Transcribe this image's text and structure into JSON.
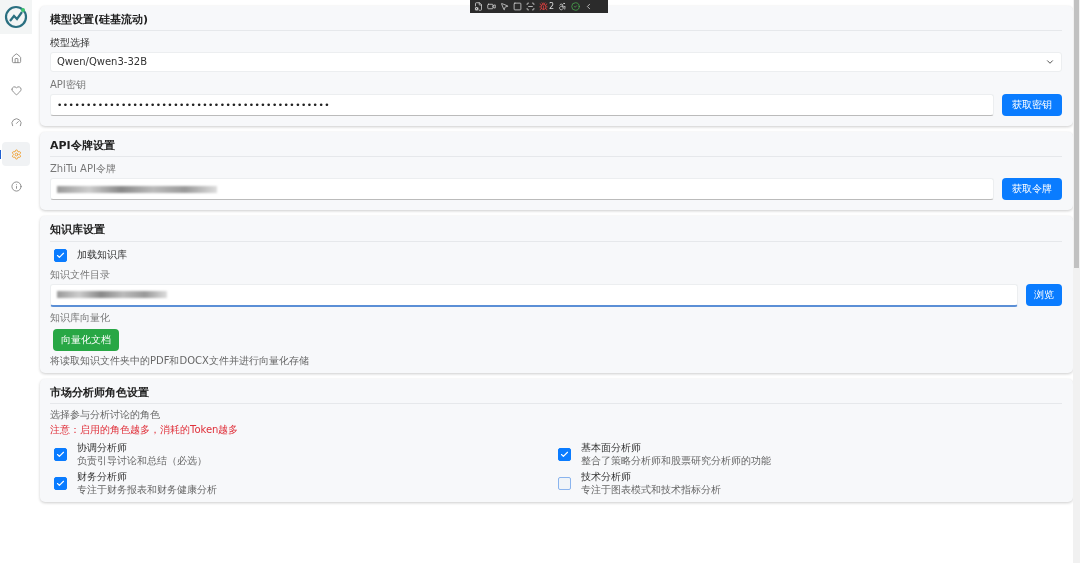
{
  "sidebar": {
    "items": [
      {
        "kind": "home",
        "selected": false
      },
      {
        "kind": "heart",
        "selected": false
      },
      {
        "kind": "gauge",
        "selected": false
      },
      {
        "kind": "settings",
        "selected": true
      },
      {
        "kind": "info",
        "selected": false
      }
    ]
  },
  "debug_toolbar": {
    "issue_count": "2"
  },
  "model_settings": {
    "title": "模型设置(硅基流动)",
    "model_label": "模型选择",
    "model_value": "Qwen/Qwen3-32B",
    "key_label": "API密钥",
    "key_value": "•••••••••••••••••••••••••••••••••••••••••••••••",
    "key_button": "获取密钥"
  },
  "token_settings": {
    "title": "API令牌设置",
    "token_label": "ZhiTu API令牌",
    "token_button": "获取令牌"
  },
  "knowledge_settings": {
    "title": "知识库设置",
    "load_label": "加载知识库",
    "load_checked": true,
    "dir_label": "知识文件目录",
    "dir_focused": true,
    "browse_button": "浏览",
    "vector_label": "知识库向量化",
    "vector_button": "向量化文档",
    "vector_hint": "将读取知识文件夹中的PDF和DOCX文件并进行向量化存储"
  },
  "analyst_settings": {
    "title": "市场分析师角色设置",
    "subtitle": "选择参与分析讨论的角色",
    "warning": "注意：启用的角色越多，消耗的Token越多",
    "roles": [
      {
        "name": "协调分析师",
        "description": "负责引导讨论和总结（必选）",
        "checked": true
      },
      {
        "name": "基本面分析师",
        "description": "整合了策略分析师和股票研究分析师的功能",
        "checked": true
      },
      {
        "name": "财务分析师",
        "description": "专注于财务报表和财务健康分析",
        "checked": true
      },
      {
        "name": "技术分析师",
        "description": "专注于图表模式和技术指标分析",
        "checked": false
      }
    ]
  }
}
